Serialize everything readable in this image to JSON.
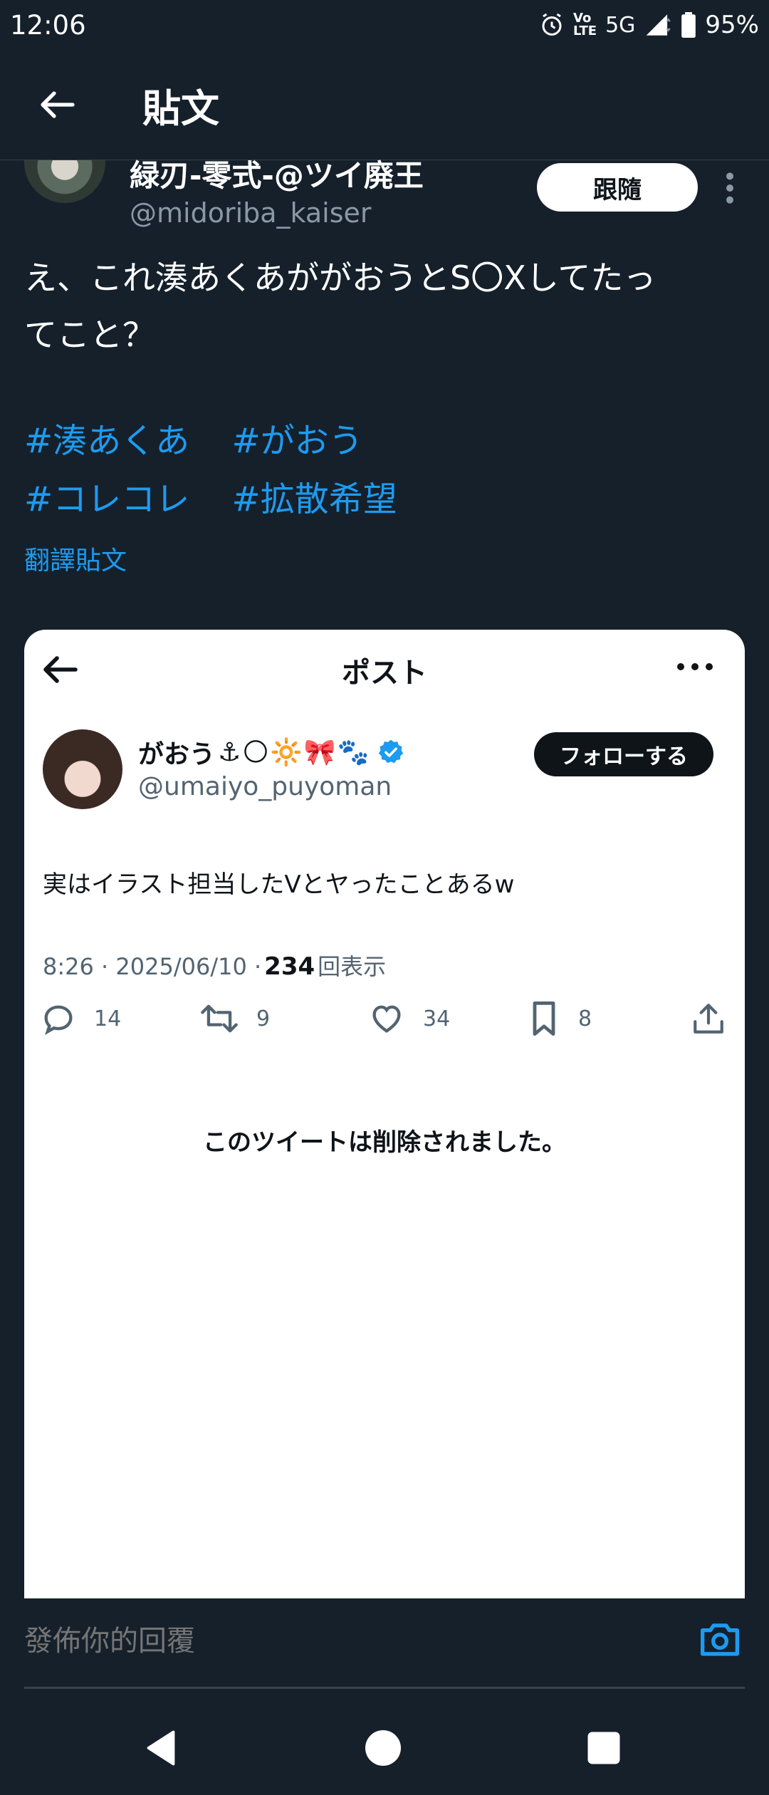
{
  "status_bar": {
    "time": "12:06",
    "volte_top": "Vo",
    "volte_bottom": "LTE",
    "network": "5G",
    "battery": "95%"
  },
  "header": {
    "title": "貼文"
  },
  "author": {
    "name": "緑刃-零式-@ツイ廃王",
    "handle": "@midoriba_kaiser",
    "follow_label": "跟隨"
  },
  "post": {
    "text_line1": "え、これ湊あくあががおうとS〇Xしてたっ",
    "text_line2": "てこと？",
    "hashtags_row1": [
      "#湊あくあ",
      "#がおう"
    ],
    "hashtags_row2": [
      "#コレコレ",
      "#拡散希望"
    ],
    "translate_label": "翻譯貼文"
  },
  "embed": {
    "header_title": "ポスト",
    "name": "がおう",
    "name_emojis": "⚓🌕🔆🎀🐾",
    "handle": "@umaiyo_puyoman",
    "follow_label": "フォローする",
    "text": "実はイラスト担当したVとヤったことあるw",
    "meta_prefix": "8:26 · 2025/06/10 ·",
    "views_count": "234",
    "views_label": "回表示",
    "replies": "14",
    "reposts": "9",
    "likes": "34",
    "bookmarks": "8",
    "deleted_notice": "このツイートは削除されました。"
  },
  "reply": {
    "placeholder": "發佈你的回覆"
  },
  "colors": {
    "background": "#15202b",
    "accent": "#1d9bf0",
    "secondary_text": "#8b98a5"
  }
}
